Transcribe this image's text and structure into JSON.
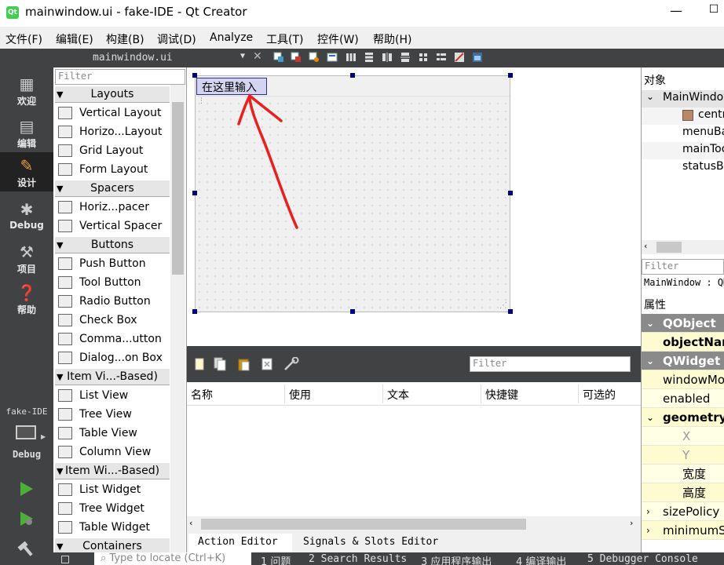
{
  "window": {
    "title": "mainwindow.ui - fake-IDE - Qt Creator",
    "app_icon": "qt-creator-icon",
    "minimize": "—",
    "maximize": "☐"
  },
  "menu": [
    "文件(F)",
    "编辑(E)",
    "构建(B)",
    "调试(D)",
    "Analyze",
    "工具(T)",
    "控件(W)",
    "帮助(H)"
  ],
  "editor": {
    "file": "mainwindow.ui",
    "close": "✕"
  },
  "modes": [
    {
      "label": "欢迎",
      "icon": "grid-icon"
    },
    {
      "label": "编辑",
      "icon": "document-icon"
    },
    {
      "label": "设计",
      "icon": "pencil-icon",
      "active": true
    },
    {
      "label": "Debug",
      "icon": "bug-icon"
    },
    {
      "label": "项目",
      "icon": "wrench-icon"
    },
    {
      "label": "帮助",
      "icon": "help-icon"
    }
  ],
  "kit": {
    "project": "fake-IDE",
    "config": "Debug"
  },
  "widget_box": {
    "filter_placeholder": "Filter",
    "sections": [
      {
        "title": "Layouts",
        "items": [
          "Vertical Layout",
          "Horizo...Layout",
          "Grid Layout",
          "Form Layout"
        ]
      },
      {
        "title": "Spacers",
        "items": [
          "Horiz...pacer",
          "Vertical Spacer"
        ]
      },
      {
        "title": "Buttons",
        "items": [
          "Push Button",
          "Tool Button",
          "Radio Button",
          "Check Box",
          "Comma...utton",
          "Dialog...on Box"
        ]
      },
      {
        "title": "Item Vi...-Based)",
        "items": [
          "List View",
          "Tree View",
          "Table View",
          "Column View"
        ]
      },
      {
        "title": "Item Wi...-Based)",
        "items": [
          "List Widget",
          "Tree Widget",
          "Table Widget"
        ]
      },
      {
        "title": "Containers",
        "items": []
      }
    ]
  },
  "form": {
    "menu_placeholder": "在这里输入",
    "annotation_color": "#e8201e"
  },
  "action_editor": {
    "filter_placeholder": "Filter",
    "columns": [
      "名称",
      "使用",
      "文本",
      "快捷键",
      "可选的"
    ],
    "tabs": [
      "Action Editor",
      "Signals & Slots Editor"
    ]
  },
  "object_inspector": {
    "label": "对象",
    "rows": [
      "MainWindow",
      "centralWidget",
      "menuBar",
      "mainToolBar",
      "statusBar"
    ]
  },
  "property_editor": {
    "filter_placeholder": "Filter",
    "class_label": "MainWindow : QMainWindow",
    "label": "属性",
    "rows": [
      {
        "text": "QObject",
        "kind": "sec",
        "tri": "⌄"
      },
      {
        "text": "objectName",
        "kind": "yel",
        "bold": true
      },
      {
        "text": "QWidget",
        "kind": "sec",
        "tri": "⌄"
      },
      {
        "text": "windowModality",
        "kind": "yel"
      },
      {
        "text": "enabled",
        "kind": "ylt"
      },
      {
        "text": "geometry",
        "kind": "yel",
        "bold": true,
        "tri": "⌄"
      },
      {
        "text": "X",
        "kind": "ylt",
        "sub": true
      },
      {
        "text": "Y",
        "kind": "yel",
        "sub": true
      },
      {
        "text": "宽度",
        "kind": "ylt",
        "sub": true
      },
      {
        "text": "高度",
        "kind": "yel",
        "sub": true
      },
      {
        "text": "sizePolicy",
        "kind": "ylt",
        "tri": "›"
      },
      {
        "text": "minimumSize",
        "kind": "yel",
        "tri": "›"
      }
    ]
  },
  "status": {
    "locate_placeholder": "Type to locate (Ctrl+K)",
    "tabs": [
      "1 问题",
      "2 Search Results",
      "3 应用程序输出",
      "4 编译输出",
      "5 Debugger Console"
    ]
  },
  "colors": {
    "dark": "#404244",
    "handle": "#000080",
    "property_section": "#8a8a8a",
    "property_row": "#fffbd0"
  }
}
